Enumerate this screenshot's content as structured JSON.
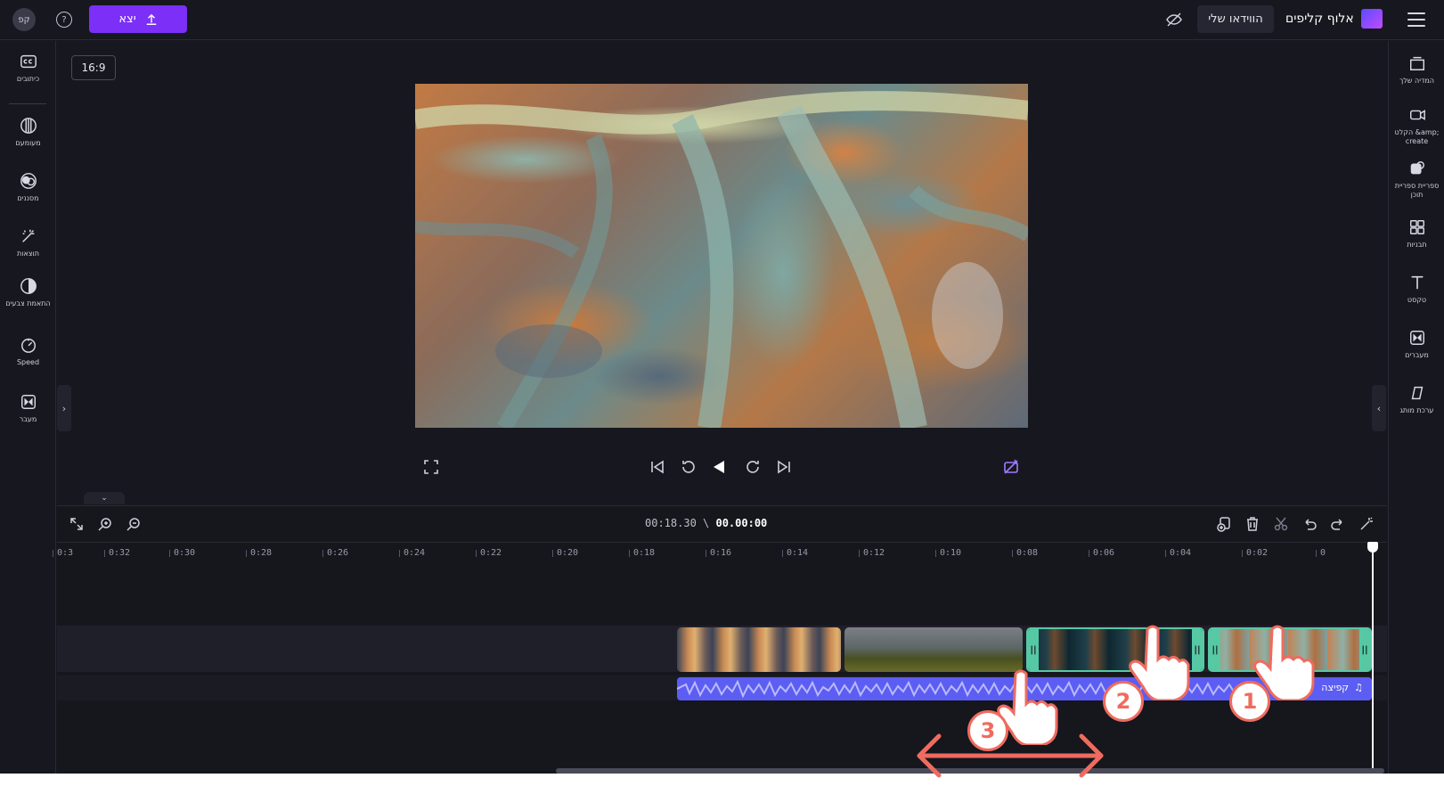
{
  "topbar": {
    "avatar_initials": "קפ",
    "export_label": "יצא",
    "my_videos_label": "הווידאו שלי",
    "brand_name": "אלוף קליפים"
  },
  "left_sidebar": {
    "items": [
      {
        "label": "כיתובים",
        "icon": "captions-icon"
      },
      {
        "label": "מעומעם",
        "icon": "fade-icon"
      },
      {
        "label": "מסננים",
        "icon": "filters-icon"
      },
      {
        "label": "תוצאות",
        "icon": "effects-icon"
      },
      {
        "label": "התאמת צבעים",
        "icon": "color-adjust-icon"
      },
      {
        "label": "Speed",
        "icon": "speed-icon"
      },
      {
        "label": "מעבר",
        "icon": "transition-icon"
      }
    ]
  },
  "right_sidebar": {
    "items": [
      {
        "label": "המדיה שלך",
        "icon": "media-icon"
      },
      {
        "label": "הקלט &amp; create",
        "icon": "record-icon"
      },
      {
        "label": "ספריית ספריית תוכן",
        "icon": "content-library-icon"
      },
      {
        "label": "תבניות",
        "icon": "templates-icon"
      },
      {
        "label": "טקסט",
        "icon": "text-icon"
      },
      {
        "label": "מעברים",
        "icon": "transitions-icon"
      },
      {
        "label": "ערכת מותג",
        "icon": "brand-kit-icon"
      }
    ]
  },
  "preview": {
    "aspect_ratio": "16:9"
  },
  "timeline": {
    "current_time": "00.00:00",
    "total_time": "00:18.30",
    "ruler_ticks": [
      "0",
      "0:02",
      "0:04",
      "0:06",
      "0:08",
      "0:10",
      "0:12",
      "0:14",
      "0:16",
      "0:18",
      "0:20",
      "0:22",
      "0:24",
      "0:26",
      "0:28",
      "0:30",
      "0:32",
      "0:3"
    ],
    "audio_label": "קפיצה"
  },
  "annotations": {
    "steps": [
      "1",
      "2",
      "3"
    ],
    "accent_color": "#ef6b5f"
  },
  "colors": {
    "accent": "#7b2ff7",
    "selection": "#56c9a4",
    "audio": "#5c5df2"
  }
}
